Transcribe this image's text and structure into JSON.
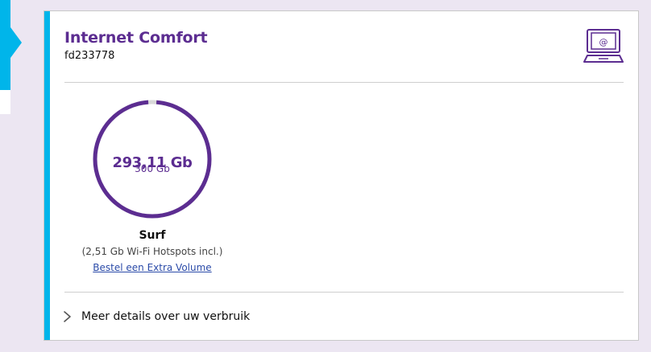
{
  "card": {
    "title": "Internet Comfort",
    "subtitle": "fd233778",
    "icon": "laptop-email-icon"
  },
  "usage": {
    "used_label": "293,11 Gb",
    "total_label": "300 Gb",
    "used": 293.11,
    "total": 300,
    "category": "Surf",
    "note": "(2,51 Gb Wi-Fi Hotspots incl.)",
    "link": "Bestel een Extra Volume"
  },
  "details": {
    "label": "Meer details over uw verbruik",
    "icon": "chevron-right-icon"
  },
  "colors": {
    "accent": "#00b5ea",
    "brand": "#5c2d91",
    "remaining": "#d9d9d9"
  }
}
